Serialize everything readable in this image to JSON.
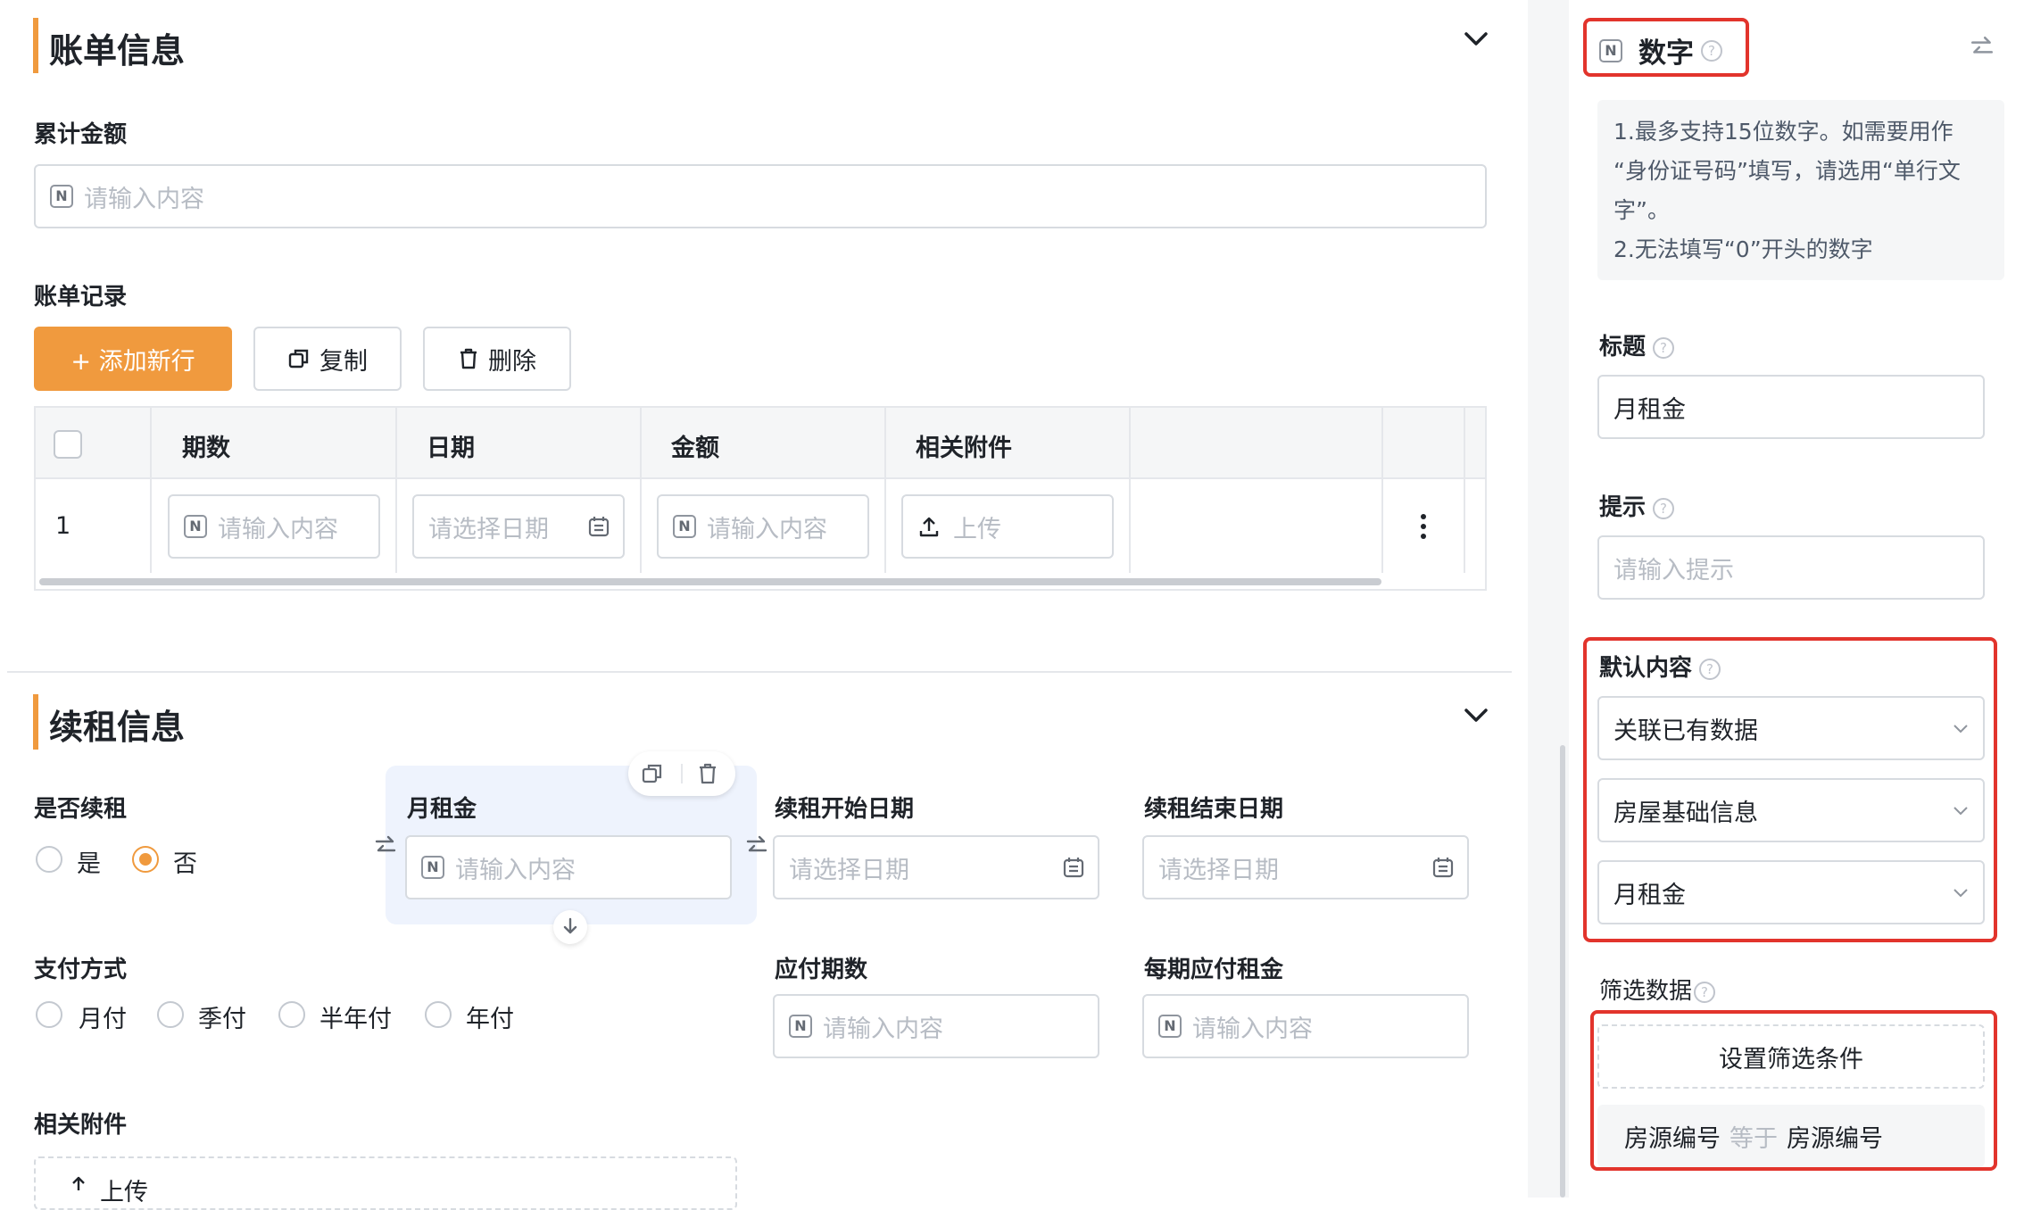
{
  "billing": {
    "title": "账单信息",
    "total_label": "累计金额",
    "total_placeholder": "请输入内容",
    "records_label": "账单记录",
    "add_label": "+ 添加新行",
    "copy_label": "复制",
    "delete_label": "删除",
    "table": {
      "headers": [
        "期数",
        "日期",
        "金额",
        "相关附件"
      ],
      "row": {
        "index": "1",
        "periods_placeholder": "请输入内容",
        "date_placeholder": "请选择日期",
        "amount_placeholder": "请输入内容",
        "upload_label": "上传"
      }
    }
  },
  "renewal": {
    "title": "续租信息",
    "renew_label": "是否续租",
    "renew_options": [
      "是",
      "否"
    ],
    "renew_selected": "否",
    "rent_label": "月租金",
    "rent_placeholder": "请输入内容",
    "start_label": "续租开始日期",
    "start_placeholder": "请选择日期",
    "end_label": "续租结束日期",
    "end_placeholder": "请选择日期",
    "pay_label": "支付方式",
    "pay_options": [
      "月付",
      "季付",
      "半年付",
      "年付"
    ],
    "due_label": "应付期数",
    "due_placeholder": "请输入内容",
    "per_label": "每期应付租金",
    "per_placeholder": "请输入内容",
    "attach_label": "相关附件",
    "upload_label": "上传"
  },
  "panel": {
    "type_label": "数字",
    "desc_line1": "1.最多支持15位数字。如需要用作",
    "desc_line2": "“身份证号码”填写，请选用“单行文",
    "desc_line3": "字”。",
    "desc_line4": "2.无法填写“0”开头的数字",
    "title_label": "标题",
    "title_value": "月租金",
    "hint_label": "提示",
    "hint_placeholder": "请输入提示",
    "default_label": "默认内容",
    "default_mode": "关联已有数据",
    "default_form": "房屋基础信息",
    "default_field": "月租金",
    "filter_label": "筛选数据",
    "filter_button": "设置筛选条件",
    "filter_cond_left": "房源编号",
    "filter_cond_op": "等于",
    "filter_cond_right": "房源编号"
  },
  "colors": {
    "accent": "#f09a3e",
    "highlight": "#e2342c",
    "selected_bg": "#eef3fd"
  }
}
